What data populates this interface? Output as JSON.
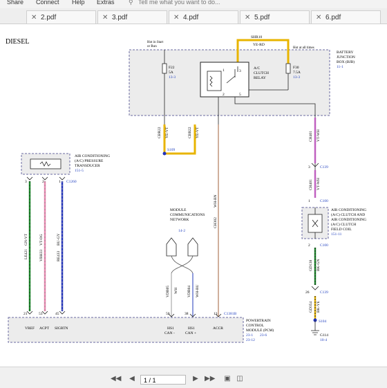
{
  "menu": [
    "Share",
    "Connect",
    "Help",
    "Extras"
  ],
  "tell_me_placeholder": "Tell me what you want to do...",
  "tabs": [
    {
      "label": "2.pdf",
      "close": "✕"
    },
    {
      "label": "3.pdf",
      "close": "✕"
    },
    {
      "label": "4.pdf",
      "close": "✕"
    },
    {
      "label": "5.pdf",
      "close": "✕"
    },
    {
      "label": "6.pdf",
      "close": "✕"
    }
  ],
  "diagram": {
    "title": "DIESEL",
    "bjb": {
      "name": "BATTERY",
      "name2": "JUNCTION",
      "name3": "BOX (BJB)",
      "ref": "11-1"
    },
    "hot_in_start": "Hot in Start",
    "or_run": "or Run",
    "hot_all_times": "Hot at all times",
    "shr": {
      "id": "SHR10",
      "color": "YE-RD"
    },
    "f22": {
      "name": "F22",
      "amp": "5A",
      "ref": "13-3"
    },
    "f30": {
      "name": "F30",
      "amp": "7.5A",
      "ref": "13-3"
    },
    "relay": {
      "l1": "A/C",
      "l2": "CLUTCH",
      "l3": "RELAY",
      "p1": "1",
      "p2": "2",
      "p3": "3",
      "p5": "5"
    },
    "cbr22": {
      "id": "CBR22",
      "color": "YE-VT"
    },
    "cbb22": {
      "id": "CBB22",
      "color": "YE-VT"
    },
    "s109": "S109",
    "ch401a": {
      "id": "CH401",
      "color": "VT-WH"
    },
    "ch401b": {
      "id": "CH401",
      "color": "VT-WH"
    },
    "c139a": {
      "pin": "3",
      "conn": "C139"
    },
    "c139b": {
      "pin": "26",
      "conn": "C139"
    },
    "c100a": {
      "pin": "1",
      "conn": "C100"
    },
    "c100b": {
      "pin": "2",
      "conn": "C100"
    },
    "ac_coil": {
      "l1": "AIR CONDITIONING",
      "l2": "(A/C) CLUTCH AND",
      "l3": "AIR CONDITIONING",
      "l4": "(A/C) CLUTCH",
      "l5": "FIELD COIL",
      "ref": "151-11"
    },
    "gd138": {
      "id": "GD138",
      "color": "BK-GN"
    },
    "gd354": {
      "id": "GD354",
      "color": "BK-YE"
    },
    "s104": "S104",
    "g114": {
      "name": "G114",
      "ref": "10-4"
    },
    "transducer": {
      "l1": "AIR CONDITIONING",
      "l2": "(A/C) PRESSURE",
      "l3": "TRANSDUCER",
      "ref": "151-5"
    },
    "t_pins": [
      "3",
      "2",
      "1"
    ],
    "c1260": "C1260",
    "wires": [
      {
        "id": "LE421",
        "color": "GN-VT"
      },
      {
        "id": "VBH33",
        "color": "VT-OG"
      },
      {
        "id": "RE433",
        "color": "BU-GY"
      },
      {
        "id": "CH302",
        "color": "WH-BN"
      },
      {
        "id": "VDB05",
        "color": "WH"
      },
      {
        "id": "VDB04",
        "color": "WH-BU"
      }
    ],
    "network": {
      "l1": "MODULE",
      "l2": "COMMUNICATIONS",
      "l3": "NETWORK",
      "ref": "14-2"
    },
    "pcm_pins": [
      "21",
      "53",
      "45",
      "50",
      "38",
      "13"
    ],
    "c1381b": "C1381B",
    "pcm_signals": [
      "VREF",
      "ACPT",
      "SIGRTN",
      "HS1",
      "CAN -",
      "HS1",
      "CAN +",
      "ACCR"
    ],
    "pcm": {
      "l1": "POWERTRAIN",
      "l2": "CONTROL",
      "l3": "MODULE (PCM)",
      "r1": "23-1",
      "r2": "23-6",
      "r3": "23-12"
    }
  },
  "statusbar": {
    "page": "1 / 1"
  },
  "colors": {
    "yellow": "#e8b400",
    "green": "#1a8a2a",
    "pink": "#e888b0",
    "blue": "#2233bb",
    "violet": "#c060c0",
    "brown": "#b07a5a",
    "ref_blue": "#1f3fbf",
    "box_gray": "#c8c8c8"
  }
}
